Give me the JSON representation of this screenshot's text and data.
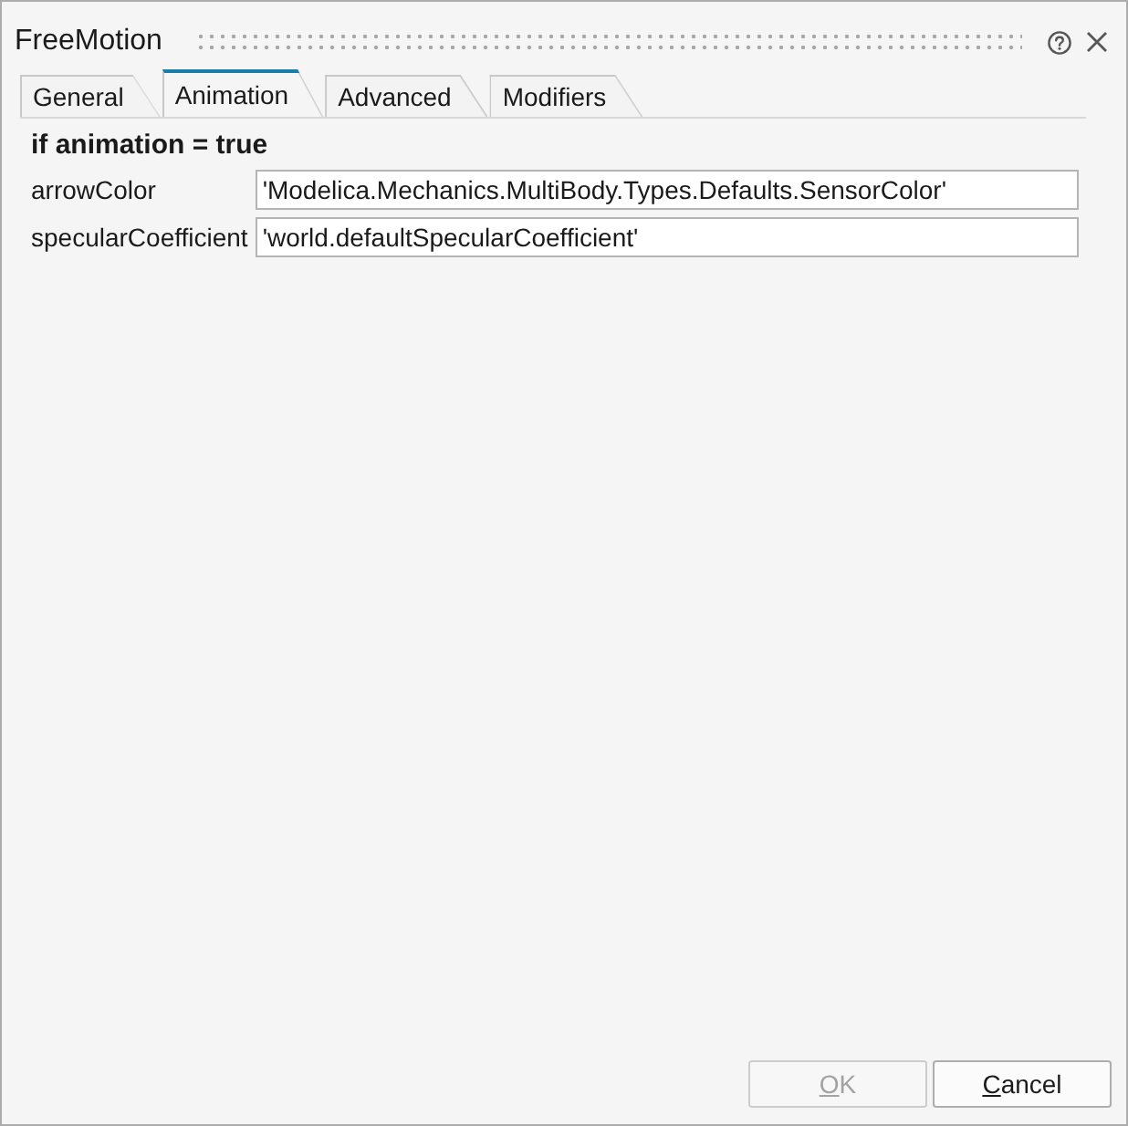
{
  "window": {
    "title": "FreeMotion"
  },
  "tabs": [
    {
      "label": "General",
      "selected": false
    },
    {
      "label": "Animation",
      "selected": true
    },
    {
      "label": "Advanced",
      "selected": false
    },
    {
      "label": "Modifiers",
      "selected": false
    }
  ],
  "section": {
    "heading": "if animation = true",
    "parameters": [
      {
        "label": "arrowColor",
        "value": "'Modelica.Mechanics.MultiBody.Types.Defaults.SensorColor'"
      },
      {
        "label": "specularCoefficient",
        "value": "'world.defaultSpecularCoefficient'"
      }
    ]
  },
  "buttons": [
    {
      "label": "OK",
      "disabled": true
    },
    {
      "label": "Cancel",
      "disabled": false
    }
  ]
}
